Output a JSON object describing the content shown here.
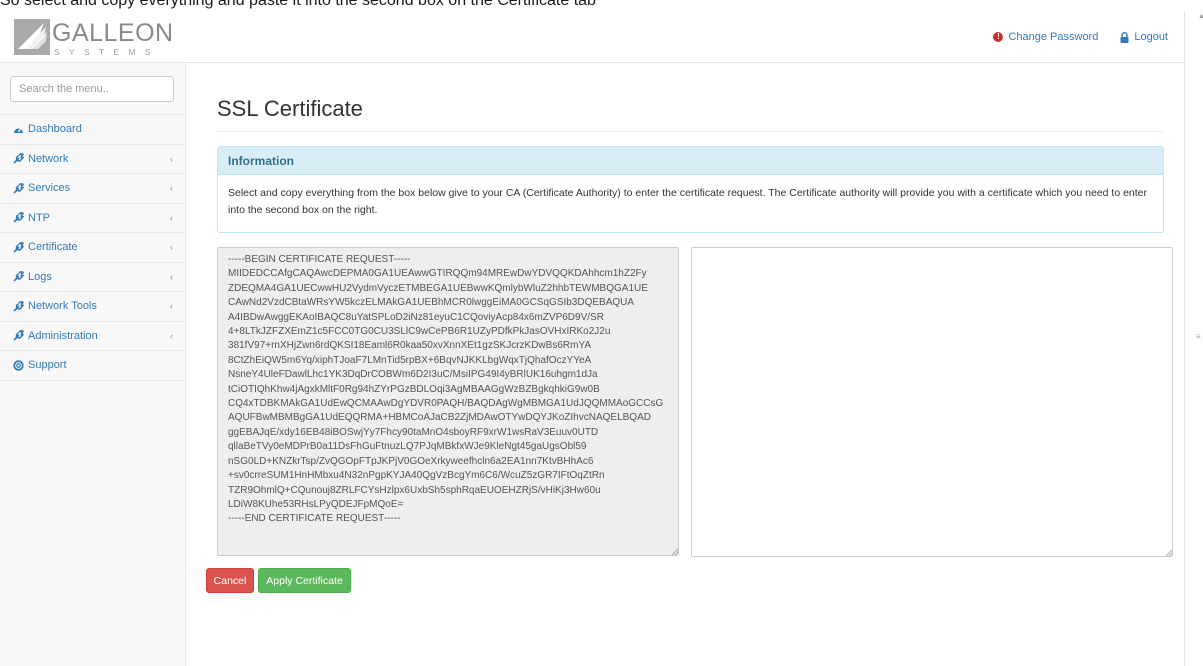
{
  "caption": "So select and copy everything and paste it into the second box on the Certificate tab",
  "brand": {
    "name": "GALLEON",
    "subtitle": "SYSTEMS"
  },
  "header": {
    "change_password": "Change Password",
    "logout": "Logout"
  },
  "sidebar": {
    "search_placeholder": "Search the menu..",
    "items": [
      {
        "label": "Dashboard",
        "icon": "dashboard-icon",
        "expandable": false
      },
      {
        "label": "Network",
        "icon": "wrench-icon",
        "expandable": true
      },
      {
        "label": "Services",
        "icon": "wrench-icon",
        "expandable": true
      },
      {
        "label": "NTP",
        "icon": "wrench-icon",
        "expandable": true
      },
      {
        "label": "Certificate",
        "icon": "wrench-icon",
        "expandable": true
      },
      {
        "label": "Logs",
        "icon": "wrench-icon",
        "expandable": true
      },
      {
        "label": "Network Tools",
        "icon": "wrench-icon",
        "expandable": true
      },
      {
        "label": "Administration",
        "icon": "wrench-icon",
        "expandable": true
      },
      {
        "label": "Support",
        "icon": "support-icon",
        "expandable": false
      }
    ]
  },
  "main": {
    "title": "SSL Certificate",
    "info_heading": "Information",
    "info_text": "Select and copy everything from the box below give to your CA (Certificate Authority) to enter the certificate request. The Certificate authority will provide you with a certificate which you need to enter into the second box on the right.",
    "csr_text": "-----BEGIN CERTIFICATE REQUEST-----\nMIIDEDCCAfgCAQAwcDEPMA0GA1UEAwwGTIRQQm94MREwDwYDVQQKDAhhcm1hZ2Fy\nZDEQMA4GA1UECwwHU2VydmVyczETMBEGA1UEBwwKQmlybWluZ2hhbTEWMBQGA1UE\nCAwNd2VzdCBtaWRsYW5kczELMAkGA1UEBhMCR0lwggEiMA0GCSqGSIb3DQEBAQUA\nA4IBDwAwggEKAoIBAQC8uYatSPLoD2iNz81eyuC1CQoviyAcp84x6mZVP6D9V/SR\n4+8LTkJZFZXEmZ1c5FCC0TG0CU3SLlC9wCePB6R1UZyPDfkPkJasOVHxIRKo2J2u\n381fV97+rnXHjZwn6rdQKSI18Eaml6R0kaa50xvXnnXEt1gzSKJcrzKDwBs6RmYA\n8CtZhEiQW5m6Yq/xiphTJoaF7LMnTid5rpBX+6BqvNJKKLbgWqxTjQhafOczYYeA\nNsneY4UleFDawlLhc1YK3DqDrCOBWm6D2I3uC/MsiIPG49I4yBRlUK16uhgm1dJa\ntCiOTIQhKhw4jAgxkMltF0Rg94hZYrPGzBDLOqi3AgMBAAGgWzBZBgkqhkiG9w0B\nCQ4xTDBKMAkGA1UdEwQCMAAwDgYDVR0PAQH/BAQDAgWgMBMGA1UdJQQMMAoGCCsG\nAQUFBwMBMBgGA1UdEQQRMA+HBMCoAJaCB2ZjMDAwOTYwDQYJKoZIhvcNAQELBQAD\nggEBAJqE/xdy16EB48iBOSwjYy7Fhcy90taMnO4sboyRF9xrW1wsRaV3Euuv0UTD\nqllaBeTVy0eMDPrB0a11DsFhGuFtnuzLQ7PJqMBkfxWJe9KleNgt45gaUgsObl59\nnSG0LD+KNZkrTsp/ZvQGOpFTpJKPjV0GOeXrkyweefhcln6a2EA1nn7KtvBHhAc6\n+sv0crreSUM1HnHMbxu4N32nPgpKYJA40QgVzBcgYm6C6/WcuZ5zGR7IFtOqZtRn\nTZR9OhmlQ+CQunouj8ZRLFCYsHzlpx6UxbSh5sphRqaEUOEHZRjS/vHiKj3Hw60u\nLDiW8KUhe53RHsLPyQDEJFpMQoE=\n-----END CERTIFICATE REQUEST-----",
    "cert_value": "",
    "cancel_label": "Cancel",
    "apply_label": "Apply Certificate"
  },
  "colors": {
    "link": "#337ab7",
    "info_bg": "#d9edf7",
    "info_text": "#31708f",
    "danger": "#d9534f",
    "success": "#5cb85c"
  }
}
